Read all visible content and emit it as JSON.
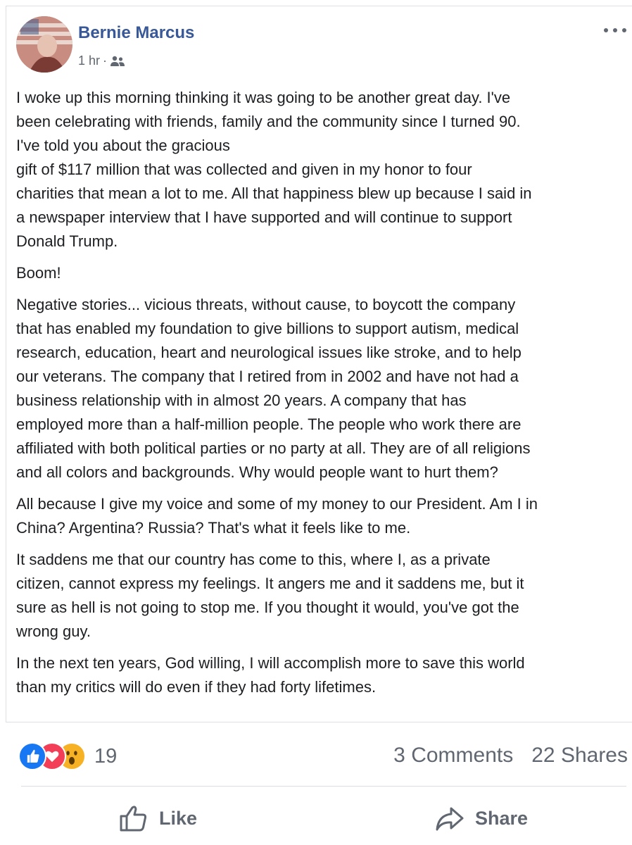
{
  "post": {
    "author": "Bernie Marcus",
    "time": "1 hr",
    "separator": "·",
    "audience_icon": "friends-icon",
    "more_icon": "more-options-icon",
    "paragraphs": [
      {
        "lines": [
          "I woke up this morning thinking it was going to be another great day. I've",
          "been celebrating with friends, family and the community since I turned 90.",
          "I've told you about the gracious",
          "gift of $117 million that was collected and given in my honor to four",
          "charities that mean a lot to me. All that happiness blew up because I said in",
          "a newspaper interview that I have supported and will continue to support",
          "Donald Trump."
        ]
      },
      {
        "lines": [
          "Boom!"
        ]
      },
      {
        "lines": [
          "Negative stories... vicious threats, without cause, to boycott the company",
          "that has enabled my foundation to give billions to support autism, medical",
          "research, education, heart and neurological issues like stroke, and to help",
          "our veterans. The company that I retired from in 2002 and have not had a",
          "business relationship with in almost 20 years. A company that has",
          "employed more than a half-million people. The people who work there are",
          "affiliated with both political parties or no party at all. They are of all religions",
          "and all colors and backgrounds. Why would people want to hurt them?"
        ]
      },
      {
        "lines": [
          "All because I give my voice and some of my money to our President. Am I in",
          "China? Argentina? Russia? That's what it feels like to me."
        ]
      },
      {
        "lines": [
          "It saddens me that our country has come to this, where I, as a private",
          "citizen, cannot express my feelings. It angers me and it saddens me, but it",
          "sure as hell is not going to stop me. If you thought it would, you've got the",
          "wrong guy."
        ]
      },
      {
        "lines": [
          "In the next ten years, God willing, I will accomplish more to save this world",
          "than my critics will do even if they had forty lifetimes."
        ]
      }
    ]
  },
  "engagement": {
    "reaction_icons": [
      "like-reaction-icon",
      "love-reaction-icon",
      "wow-reaction-icon"
    ],
    "reaction_count": "19",
    "comments": "3 Comments",
    "shares": "22 Shares"
  },
  "actions": {
    "like_label": "Like",
    "share_label": "Share"
  },
  "colors": {
    "author_link": "#385898",
    "secondary_text": "#606770",
    "like_blue": "#1877f2",
    "love_red": "#f33e58",
    "wow_yellow": "#f7b125"
  }
}
